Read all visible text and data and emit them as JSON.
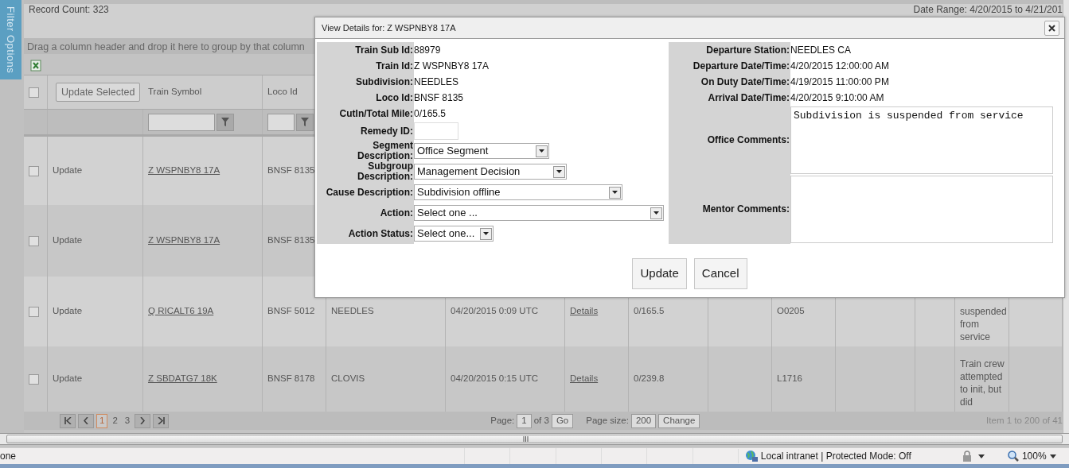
{
  "sidebar_tab": {
    "label": "Filter Options"
  },
  "header": {
    "record_count": "Record Count: 323",
    "date_range": "Date Range: 4/20/2015 to 4/21/201"
  },
  "group_panel": {
    "hint": "Drag a column header and drop it here to group by that column"
  },
  "grid": {
    "select_all": {
      "checked": false
    },
    "update_selected": "Update Selected",
    "columns": [
      "Train Symbol",
      "Loco Id"
    ],
    "rows": [
      {
        "checked": false,
        "action": "Update",
        "train_symbol": "Z WSPNBY8 17A",
        "loco_id": "BNSF 8135"
      },
      {
        "checked": false,
        "action": "Update",
        "train_symbol": "Z WSPNBY8 17A",
        "loco_id": "BNSF 8135"
      },
      {
        "checked": false,
        "action": "Update",
        "train_symbol": "Q RICALT6 19A",
        "loco_id": "BNSF 5012",
        "column_5": "NEEDLES",
        "column_6": "04/20/2015 0:09 UTC",
        "column_7": "Details",
        "column_8": "0/165.5",
        "column_10": "O0205",
        "column_13": "suspended from service"
      },
      {
        "checked": false,
        "action": "Update",
        "train_symbol": "Z SBDATG7 18K",
        "loco_id": "BNSF 8178",
        "column_5": "CLOVIS",
        "column_6": "04/20/2015 0:15 UTC",
        "column_7": "Details",
        "column_8": "0/239.8",
        "column_10": "L1716",
        "column_13": "Train crew attempted to init, but did"
      }
    ],
    "pager": {
      "pages": [
        {
          "label": "1",
          "selected": true
        },
        {
          "label": "2",
          "selected": false
        },
        {
          "label": "3",
          "selected": false
        }
      ],
      "page_label": "Page:",
      "page_value": "1",
      "page_of": "of 3",
      "go": "Go",
      "size_label": "Page size:",
      "size_value": "200",
      "change": "Change",
      "summary": "Item 1 to 200 of 41"
    }
  },
  "dialog": {
    "title": "View Details for: Z WSPNBY8 17A",
    "left_fields": [
      {
        "kind": "text",
        "label": "Train Sub Id:",
        "value": "88979"
      },
      {
        "kind": "text",
        "label": "Train Id:",
        "value": "Z WSPNBY8 17A"
      },
      {
        "kind": "text",
        "label": "Subdivision:",
        "value": "NEEDLES"
      },
      {
        "kind": "text",
        "label": "Loco Id:",
        "value": "BNSF 8135"
      },
      {
        "kind": "text",
        "label": "CutIn/Total Mile:",
        "value": "0/165.5"
      },
      {
        "kind": "input",
        "label": "Remedy ID:"
      },
      {
        "kind": "select",
        "label": "Segment Description:",
        "value": "Office Segment"
      },
      {
        "kind": "select",
        "label": "Subgroup Description:",
        "value": "Management Decision"
      },
      {
        "kind": "select",
        "label": "Cause Description:",
        "value": "Subdivision offline"
      },
      {
        "kind": "select",
        "label": "Action:",
        "value": "Select one ..."
      },
      {
        "kind": "select",
        "label": "Action Status:",
        "value": "Select one..."
      }
    ],
    "right_fields": [
      {
        "kind": "text",
        "label": "Departure Station:",
        "value": "NEEDLES CA"
      },
      {
        "kind": "text",
        "label": "Departure Date/Time:",
        "value": "4/20/2015 12:00:00 AM"
      },
      {
        "kind": "text",
        "label": "On Duty Date/Time:",
        "value": "4/19/2015 11:00:00 PM"
      },
      {
        "kind": "text",
        "label": "Arrival Date/Time:",
        "value": "4/20/2015 9:10:00 AM"
      },
      {
        "kind": "textarea",
        "label": "Office Comments:",
        "value": "Subdivision is suspended from service"
      },
      {
        "kind": "textarea",
        "label": "Mentor Comments:"
      }
    ],
    "buttons": [
      "Update",
      "Cancel"
    ]
  },
  "status_bar": {
    "status": "one",
    "zone": "Local intranet | Protected Mode: Off",
    "zoom": "100%"
  }
}
